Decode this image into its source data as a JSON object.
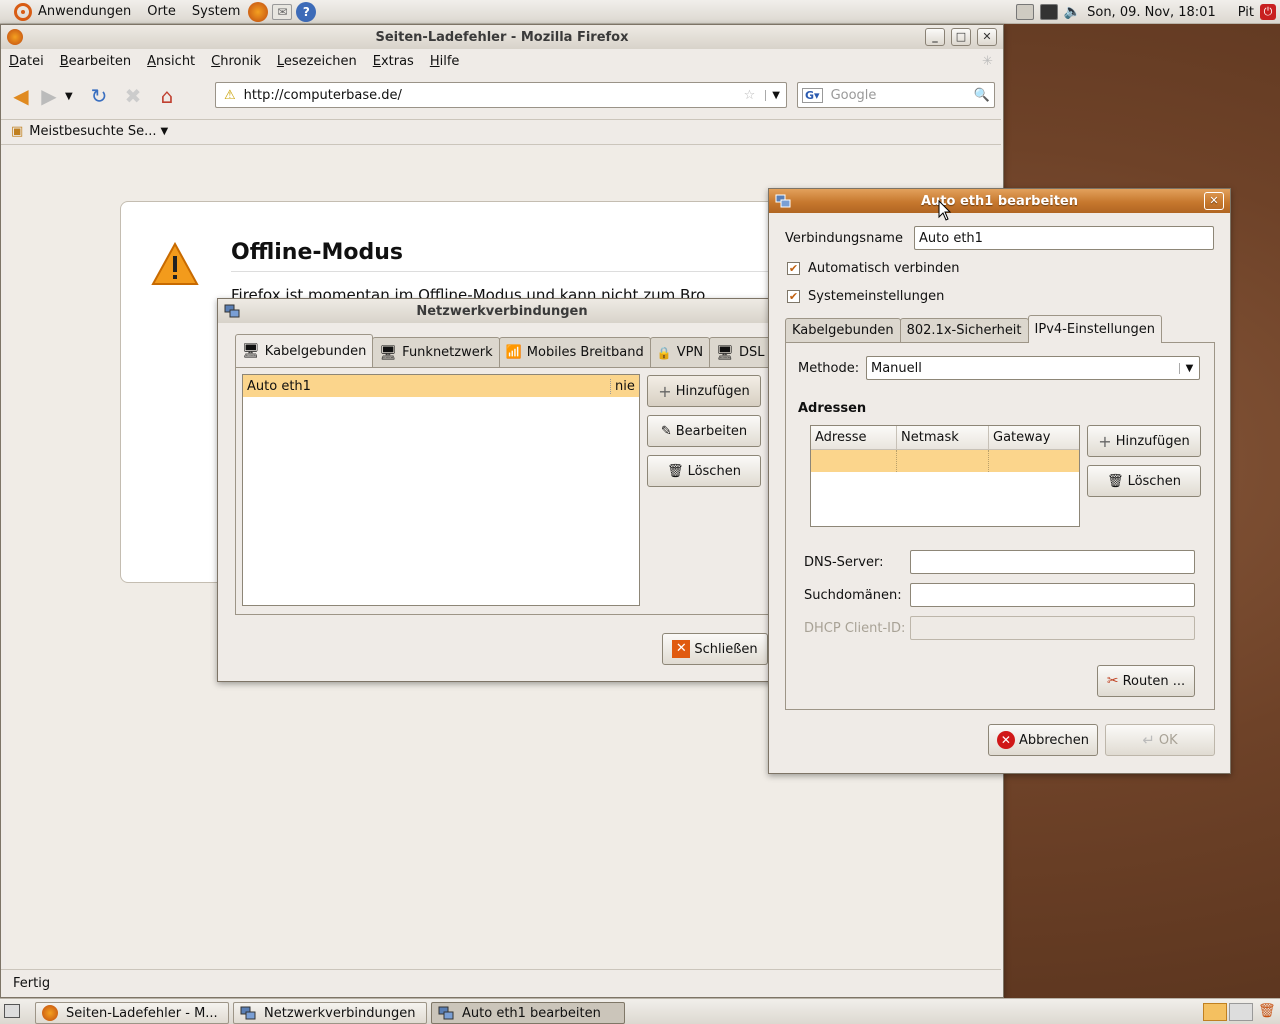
{
  "top_panel": {
    "menus": [
      "Anwendungen",
      "Orte",
      "System"
    ],
    "launchers": [
      "firefox-icon",
      "mail-icon",
      "help-icon"
    ],
    "clock": "Son, 09. Nov, 18:01",
    "user": "Pit"
  },
  "firefox": {
    "title": "Seiten-Ladefehler - Mozilla Firefox",
    "menu": [
      {
        "label": "Datei",
        "u": "D",
        "rest": "atei"
      },
      {
        "label": "Bearbeiten",
        "u": "B",
        "rest": "earbeiten"
      },
      {
        "label": "Ansicht",
        "u": "A",
        "rest": "nsicht"
      },
      {
        "label": "Chronik",
        "u": "C",
        "rest": "hronik"
      },
      {
        "label": "Lesezeichen",
        "u": "L",
        "rest": "esezeichen"
      },
      {
        "label": "Extras",
        "u": "E",
        "rest": "xtras"
      },
      {
        "label": "Hilfe",
        "u": "H",
        "rest": "ilfe"
      }
    ],
    "url": "http://computerbase.de/",
    "search_placeholder": "Google",
    "bookmark": "Meistbesuchte Se...",
    "error_title": "Offline-Modus",
    "error_text": "Firefox ist momentan im Offline-Modus und kann nicht zum Bro",
    "status": "Fertig"
  },
  "netz": {
    "title": "Netzwerkverbindungen",
    "tabs": [
      "Kabelgebunden",
      "Funknetzwerk",
      "Mobiles Breitband",
      "VPN",
      "DSL"
    ],
    "connections": [
      {
        "name": "Auto eth1",
        "last": "nie"
      }
    ],
    "buttons": {
      "add": "Hinzufügen",
      "edit": "Bearbeiten",
      "delete": "Löschen",
      "close": "Schließen"
    }
  },
  "edit": {
    "title": "Auto eth1 bearbeiten",
    "name_label": "Verbindungsname",
    "name_value": "Auto eth1",
    "auto_connect": "Automatisch verbinden",
    "system_settings": "Systemeinstellungen",
    "tabs": [
      "Kabelgebunden",
      "802.1x-Sicherheit",
      "IPv4-Einstellungen"
    ],
    "method_label": "Methode:",
    "method_value": "Manuell",
    "addresses_label": "Adressen",
    "columns": [
      "Adresse",
      "Netmask",
      "Gateway"
    ],
    "add": "Hinzufügen",
    "delete": "Löschen",
    "dns_label": "DNS-Server:",
    "search_label": "Suchdomänen:",
    "dhcp_label": "DHCP Client-ID:",
    "routes": "Routen ...",
    "cancel": "Abbrechen",
    "ok": "OK"
  },
  "taskbar": {
    "items": [
      "Seiten-Ladefehler - M...",
      "Netzwerkverbindungen",
      "Auto eth1 bearbeiten"
    ]
  }
}
